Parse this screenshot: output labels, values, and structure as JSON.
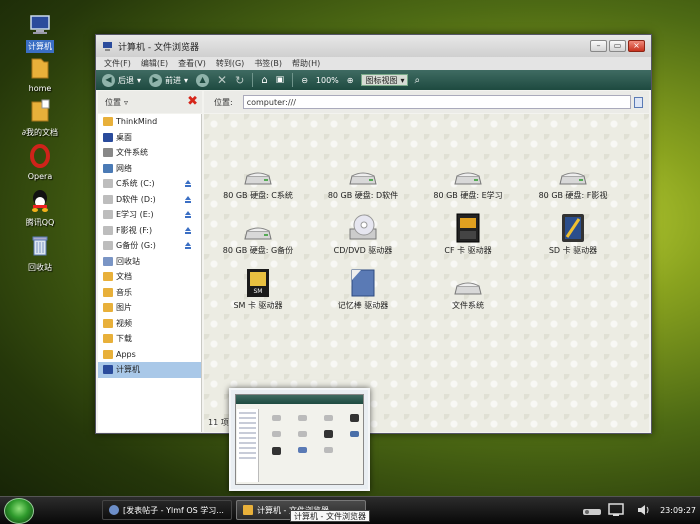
{
  "desktop": {
    "icons": [
      {
        "label": "计算机",
        "icon": "computer-icon"
      },
      {
        "label": "home",
        "icon": "folder-icon"
      },
      {
        "label": "∂我的文档",
        "icon": "documents-icon"
      },
      {
        "label": "Opera",
        "icon": "opera-icon"
      },
      {
        "label": "腾讯QQ",
        "icon": "qq-icon"
      },
      {
        "label": "回收站",
        "icon": "trash-icon"
      }
    ]
  },
  "window": {
    "title": "计算机 - 文件浏览器",
    "menu": [
      "文件(F)",
      "编辑(E)",
      "查看(V)",
      "转到(G)",
      "书签(B)",
      "帮助(H)"
    ],
    "toolbar": {
      "back": "后退",
      "forward": "前进",
      "zoom": "100%",
      "view_mode": "图标视图"
    },
    "sidebar_header": "位置",
    "location_label": "位置:",
    "location_value": "computer:///",
    "sidebar": [
      {
        "label": "ThinkMind",
        "icon": "home-folder-icon"
      },
      {
        "label": "桌面",
        "icon": "desktop-icon"
      },
      {
        "label": "文件系统",
        "icon": "filesystem-icon"
      },
      {
        "label": "网络",
        "icon": "network-icon"
      },
      {
        "label": "C系统 (C:)",
        "icon": "drive-icon",
        "eject": true
      },
      {
        "label": "D软件 (D:)",
        "icon": "drive-icon",
        "eject": true
      },
      {
        "label": "E学习 (E:)",
        "icon": "drive-icon",
        "eject": true
      },
      {
        "label": "F影视 (F:)",
        "icon": "drive-icon",
        "eject": true
      },
      {
        "label": "G备份 (G:)",
        "icon": "drive-icon",
        "eject": true
      },
      {
        "label": "回收站",
        "icon": "trash-icon"
      },
      {
        "label": "文档",
        "icon": "folder-icon"
      },
      {
        "label": "音乐",
        "icon": "folder-icon"
      },
      {
        "label": "图片",
        "icon": "folder-icon"
      },
      {
        "label": "视频",
        "icon": "folder-icon"
      },
      {
        "label": "下载",
        "icon": "folder-icon"
      },
      {
        "label": "Apps",
        "icon": "folder-icon"
      },
      {
        "label": "计算机",
        "icon": "computer-icon",
        "selected": true
      }
    ],
    "items": [
      {
        "label": "80 GB 硬盘: C系统",
        "icon": "hard-drive-icon"
      },
      {
        "label": "80 GB 硬盘: D软件",
        "icon": "hard-drive-icon"
      },
      {
        "label": "80 GB 硬盘: E学习",
        "icon": "hard-drive-icon"
      },
      {
        "label": "80 GB 硬盘: F影视",
        "icon": "hard-drive-icon"
      },
      {
        "label": "80 GB 硬盘: G备份",
        "icon": "hard-drive-icon"
      },
      {
        "label": "CD/DVD 驱动器",
        "icon": "cd-drive-icon"
      },
      {
        "label": "CF 卡 驱动器",
        "icon": "cf-card-icon"
      },
      {
        "label": "SD 卡 驱动器",
        "icon": "sd-card-icon"
      },
      {
        "label": "SM 卡 驱动器",
        "icon": "sm-card-icon"
      },
      {
        "label": "记忆棒 驱动器",
        "icon": "memory-stick-icon"
      },
      {
        "label": "文件系统",
        "icon": "filesystem-icon"
      }
    ],
    "status": "11 项"
  },
  "taskbar": {
    "tasks": [
      {
        "label": "[发表帖子 - Ylmf OS 学习...",
        "icon": "browser-icon"
      },
      {
        "label": "计算机 - 文件浏览器",
        "icon": "folder-icon",
        "active": true
      }
    ],
    "tooltip": "计算机 - 文件浏览器",
    "clock": "23:09:27"
  },
  "colors": {
    "toolbar": "#2e5a50",
    "selection": "#a9c8e8",
    "accent": "#d6261a"
  }
}
